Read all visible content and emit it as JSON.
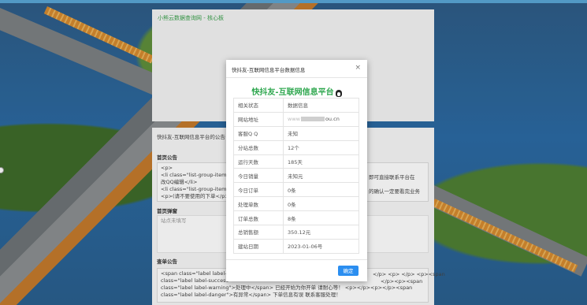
{
  "background_page": {
    "header_title": "小熊云数据查询网 - 核心板",
    "notice_intro": "快抖友-互联网信息平台的公告",
    "section_homepage_notice": "首页公告",
    "homepage_notice_code_lines": [
      "<p>",
      "<li class=\"list-group-item\"",
      "改QQ编辑</li>",
      "<li class=\"list-group-item\"",
      "<p>(请不要使用的下单</p>"
    ],
    "homepage_notice_right_1": "即可直接联系平台在",
    "homepage_notice_right_2": "的确认一定要看完业务",
    "section_popup": "首页弹窗",
    "popup_placeholder": "站点未填写",
    "section_order_notice": "查单公告",
    "order_notice_code_lines": [
      "<span class=\"label label-p",
      "class=\"label label-success\"",
      "class=\"label label-warning\">处理中</span> 已经开始为你开单 请耐心等！ <p></p><p></p><span",
      "class=\"label label-danger\">有异常</span> 下单信息有误 联系客服处理！"
    ],
    "order_notice_right_1": "</p> <p> </p> <p><span",
    "order_notice_right_2": "</p><p><span"
  },
  "modal": {
    "title": "快抖友-互联网信息平台数据信息",
    "close_symbol": "×",
    "brand_name": "快抖友-互联网信息平台",
    "table_header": {
      "col1": "相关状态",
      "col2": "数据信息"
    },
    "rows": [
      {
        "label": "网站地址",
        "value_prefix": "www",
        "value_suffix": "ou.cn"
      },
      {
        "label": "客服Q Q",
        "value": "未知"
      },
      {
        "label": "分站总数",
        "value": "12个"
      },
      {
        "label": "运行天数",
        "value": "185天"
      },
      {
        "label": "今日销量",
        "value": "未知元"
      },
      {
        "label": "今日订单",
        "value": "0条"
      },
      {
        "label": "处理单数",
        "value": "0条"
      },
      {
        "label": "订单总数",
        "value": "8条"
      },
      {
        "label": "总销售额",
        "value": "350.12元"
      },
      {
        "label": "建站日期",
        "value": "2023-01-06号"
      }
    ],
    "ok_label": "确定"
  },
  "colors": {
    "brand": "#2fa74f",
    "ok_button": "#2b8ef0"
  }
}
